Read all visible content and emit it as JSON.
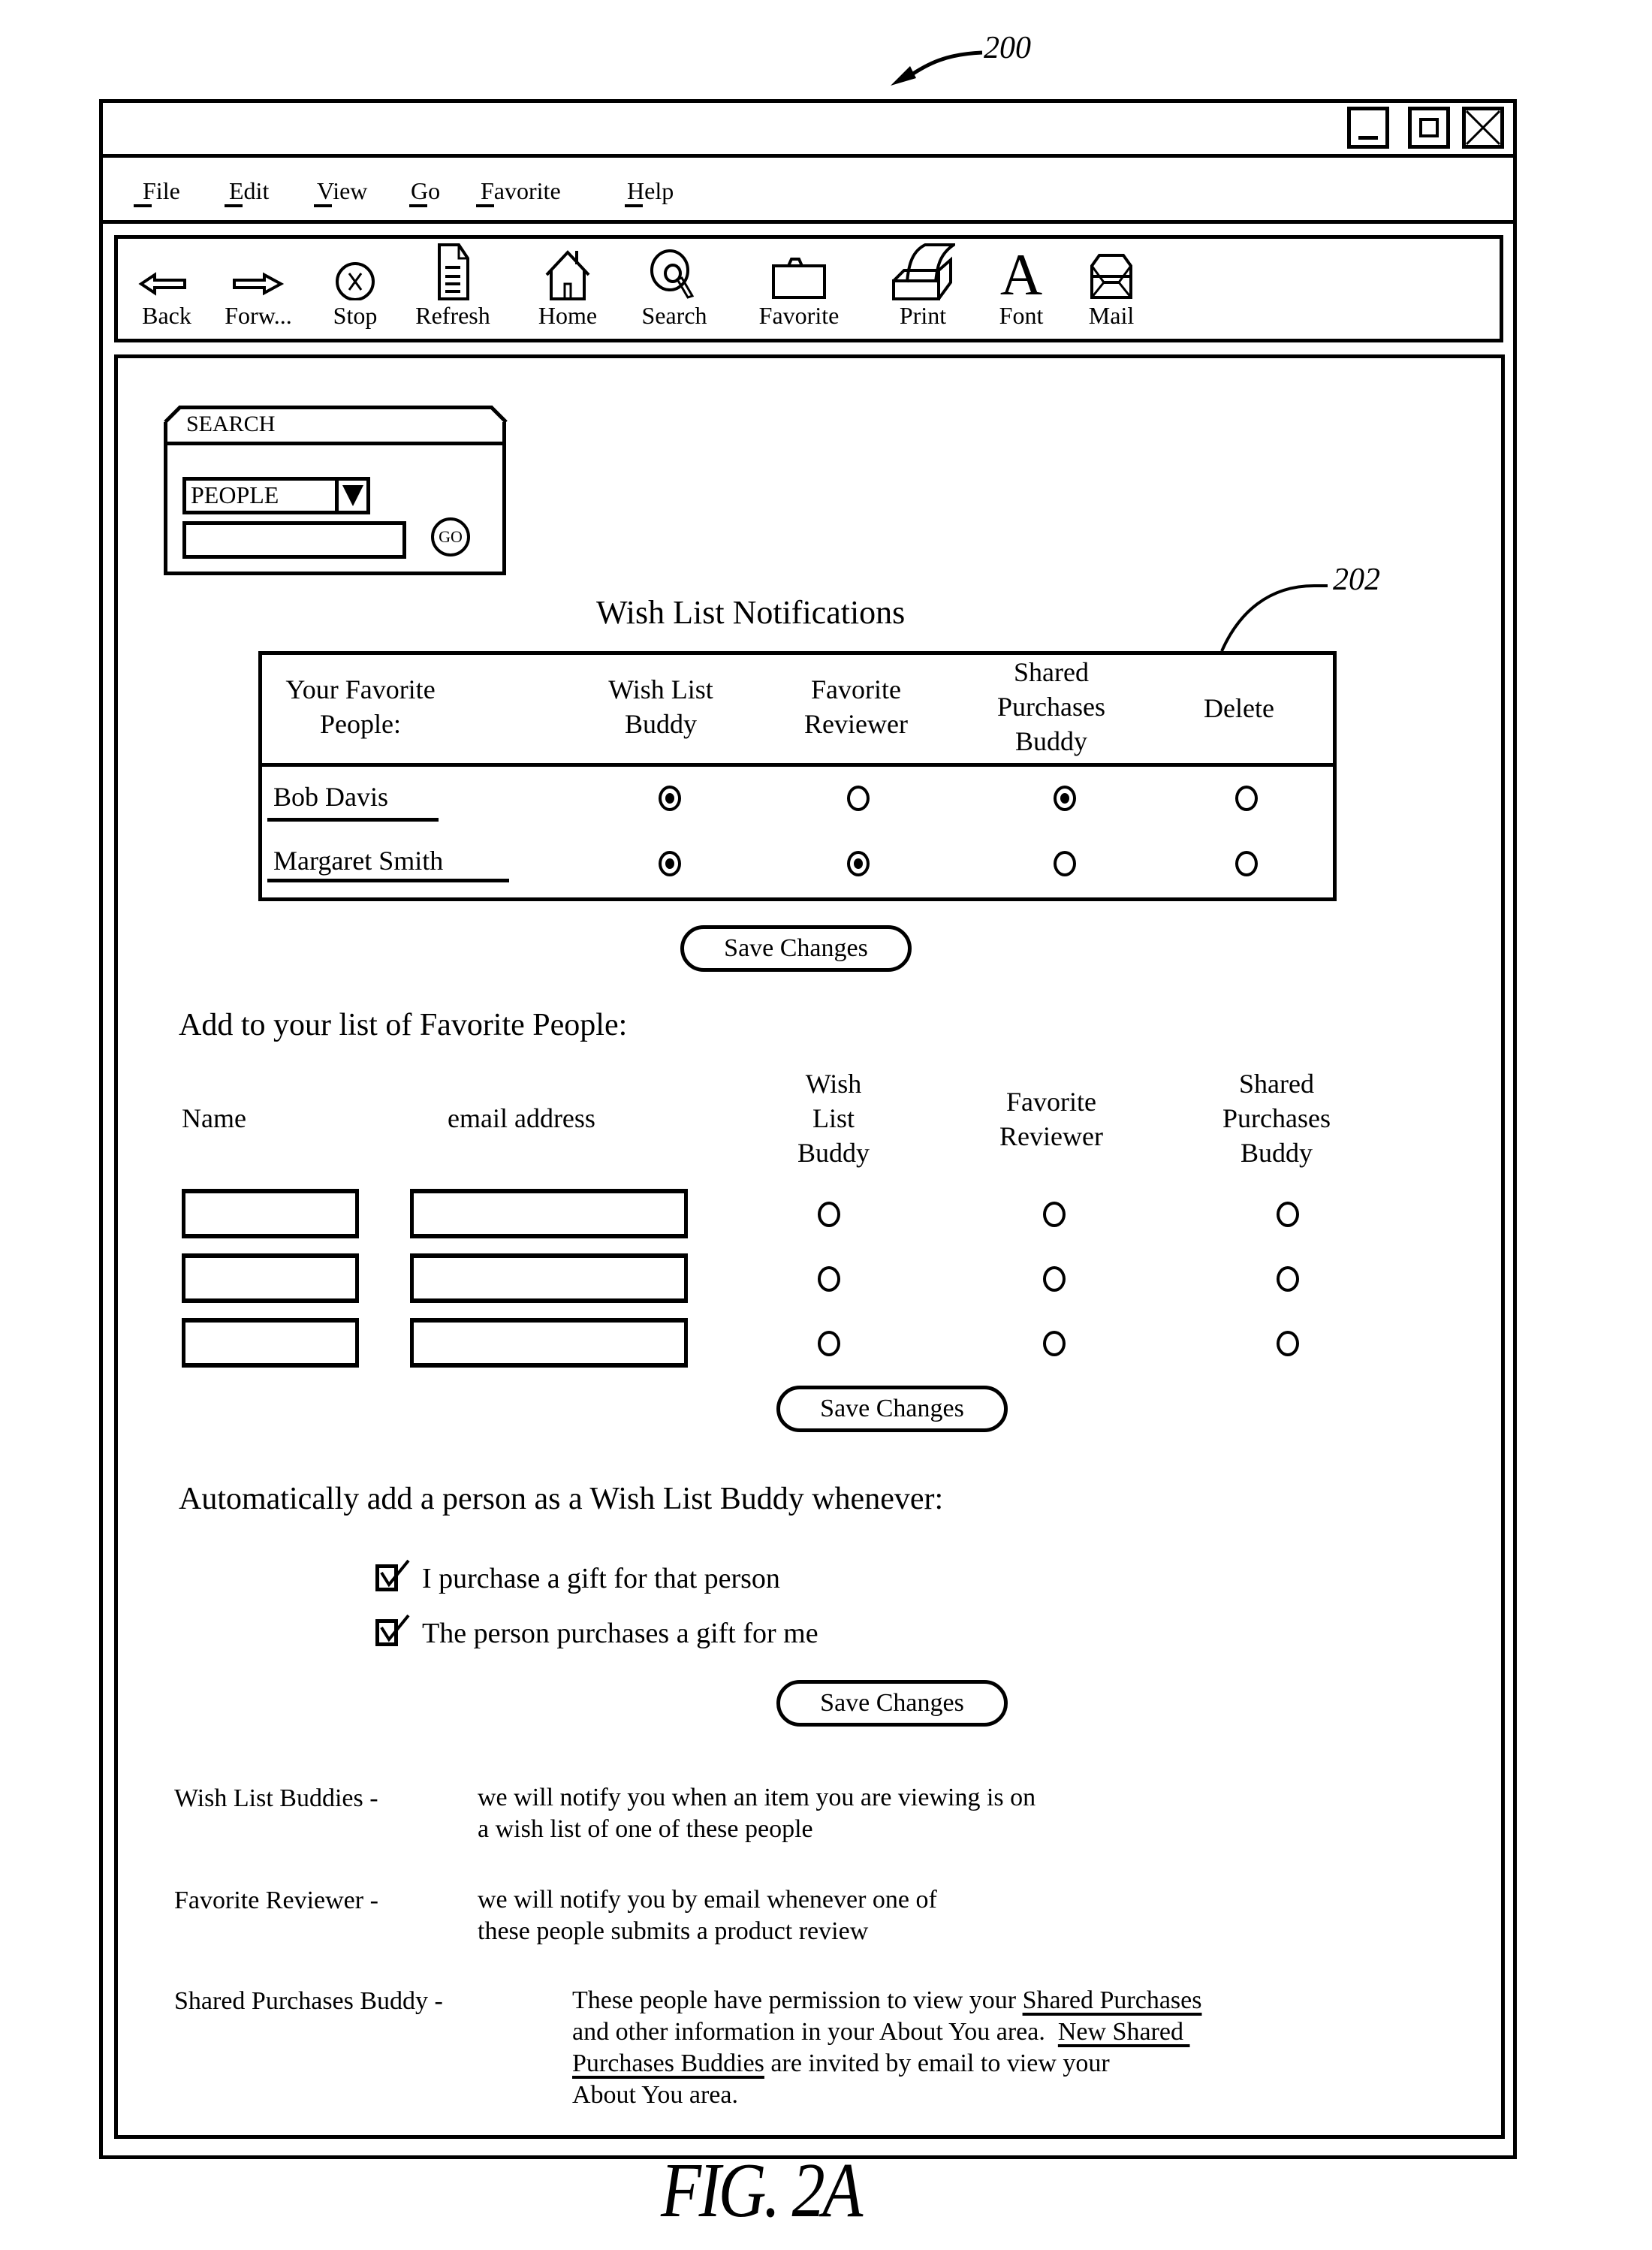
{
  "figure": {
    "label": "FIG. 2A",
    "ref_window": "200",
    "ref_table": "202"
  },
  "window": {
    "controls": [
      {
        "name": "minimize",
        "icon": "minimize-icon"
      },
      {
        "name": "maximize",
        "icon": "maximize-icon"
      },
      {
        "name": "close",
        "icon": "close-icon"
      }
    ]
  },
  "menu": {
    "items": [
      {
        "label": "File",
        "mnemonic": "F"
      },
      {
        "label": "Edit",
        "mnemonic": "E"
      },
      {
        "label": "View",
        "mnemonic": "V"
      },
      {
        "label": "Go",
        "mnemonic": "G"
      },
      {
        "label": "Favorite",
        "mnemonic": "F"
      },
      {
        "label": "Help",
        "mnemonic": "H"
      }
    ]
  },
  "toolbar": {
    "items": [
      {
        "label": "Back",
        "icon": "back-arrow-icon"
      },
      {
        "label": "Forw...",
        "icon": "forward-arrow-icon"
      },
      {
        "label": "Stop",
        "icon": "stop-icon"
      },
      {
        "label": "Refresh",
        "icon": "document-icon"
      },
      {
        "label": "Home",
        "icon": "home-icon"
      },
      {
        "label": "Search",
        "icon": "magnifier-icon"
      },
      {
        "label": "Favorite",
        "icon": "folder-icon"
      },
      {
        "label": "Print",
        "icon": "printer-icon"
      },
      {
        "label": "Font",
        "icon": "font-icon"
      },
      {
        "label": "Mail",
        "icon": "envelope-icon"
      }
    ]
  },
  "search": {
    "title": "SEARCH",
    "category": "PEOPLE",
    "query": "",
    "go_label": "GO"
  },
  "notifications": {
    "title": "Wish List Notifications",
    "columns": [
      "Your Favorite People:",
      "Wish List Buddy",
      "Favorite Reviewer",
      "Shared Purchases Buddy",
      "Delete"
    ],
    "column_lines": [
      [
        "Your Favorite",
        "People:"
      ],
      [
        "Wish List",
        "Buddy"
      ],
      [
        "Favorite",
        "Reviewer"
      ],
      [
        "Shared",
        "Purchases",
        "Buddy"
      ],
      [
        "Delete"
      ]
    ],
    "rows": [
      {
        "name": "Bob Davis",
        "wish_list_buddy": true,
        "favorite_reviewer": false,
        "shared_purchases_buddy": true,
        "delete": false
      },
      {
        "name": "Margaret Smith",
        "wish_list_buddy": true,
        "favorite_reviewer": true,
        "shared_purchases_buddy": false,
        "delete": false
      }
    ],
    "save_label": "Save Changes"
  },
  "add_people": {
    "title": "Add to your list of Favorite People:",
    "name_header": "Name",
    "email_header": "email address",
    "option_headers": [
      [
        "Wish",
        "List",
        "Buddy"
      ],
      [
        "Favorite",
        "Reviewer"
      ],
      [
        "Shared",
        "Purchases",
        "Buddy"
      ]
    ],
    "rows": [
      {
        "name": "",
        "email": "",
        "wish_list_buddy": false,
        "favorite_reviewer": false,
        "shared_purchases_buddy": false
      },
      {
        "name": "",
        "email": "",
        "wish_list_buddy": false,
        "favorite_reviewer": false,
        "shared_purchases_buddy": false
      },
      {
        "name": "",
        "email": "",
        "wish_list_buddy": false,
        "favorite_reviewer": false,
        "shared_purchases_buddy": false
      }
    ],
    "save_label": "Save Changes"
  },
  "auto_add": {
    "title": "Automatically add a person as a Wish List Buddy whenever:",
    "options": [
      {
        "label": "I purchase a gift for that person",
        "checked": true
      },
      {
        "label": "The person purchases a gift for me",
        "checked": true
      }
    ],
    "save_label": "Save Changes"
  },
  "definitions": [
    {
      "term": "Wish List Buddies -",
      "lines": [
        "we will notify you when an item you are viewing is on",
        "a wish list of one of these people"
      ]
    },
    {
      "term": "Favorite Reviewer -",
      "lines": [
        "we will notify you by email whenever one of",
        "these people submits a product review"
      ]
    },
    {
      "term": "Shared Purchases Buddy -",
      "segments": {
        "l1_text": "These people have permission to view your ",
        "l1_link": "Shared Purchases",
        "l2_text": "and other information in your About You area.  ",
        "l2_link": "New Shared ",
        "l3_link": "Purchases Buddies",
        "l3_text": " are invited by email to view your",
        "l4_text": "About You area."
      }
    }
  ]
}
